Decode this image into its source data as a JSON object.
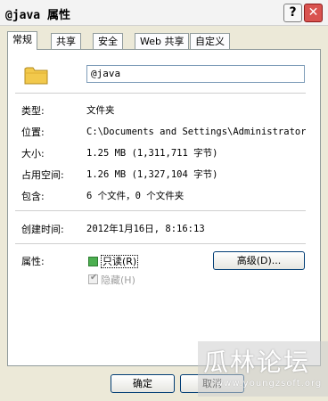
{
  "window": {
    "title": "@java 属性",
    "help_label": "?",
    "close_label": "✕"
  },
  "tabs": [
    {
      "label": "常规",
      "active": true
    },
    {
      "label": "共享"
    },
    {
      "label": "安全"
    },
    {
      "label": "Web 共享"
    },
    {
      "label": "自定义"
    }
  ],
  "general": {
    "icon": "folder-icon",
    "name_value": "@java",
    "type": {
      "label": "类型:",
      "value": "文件夹"
    },
    "location": {
      "label": "位置:",
      "value": "C:\\Documents and Settings\\Administrator\\桌"
    },
    "size": {
      "label": "大小:",
      "value": "1.25 MB (1,311,711 字节)"
    },
    "size_on_disk": {
      "label": "占用空间:",
      "value": "1.26 MB (1,327,104 字节)"
    },
    "contains": {
      "label": "包含:",
      "value": "6 个文件，0 个文件夹"
    },
    "created": {
      "label": "创建时间:",
      "value": "2012年1月16日, 8:16:13"
    },
    "attributes": {
      "label": "属性:",
      "readonly_label": "只读(R)",
      "hidden_label": "隐藏(H)",
      "advanced_label": "高级(D)..."
    }
  },
  "footer": {
    "ok_label": "确定",
    "cancel_label": "取消"
  },
  "watermark": {
    "text": "瓜林论坛",
    "url": "www.youngzsoft.org"
  },
  "colors": {
    "window_bg": "#ece9d8",
    "close_button": "#d9534f",
    "readonly_checkbox": "#4caf50"
  }
}
